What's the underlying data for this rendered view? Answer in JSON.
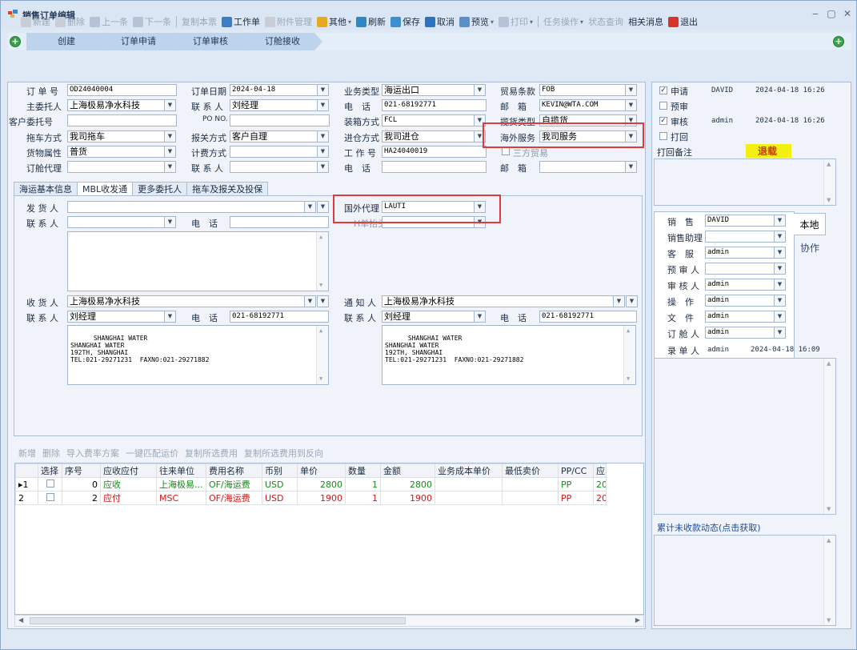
{
  "window": {
    "title": "销售订单编辑"
  },
  "toolbar": [
    {
      "label": "新建",
      "icon": "new-icon",
      "disabled": true
    },
    {
      "label": "删除",
      "icon": "delete-icon",
      "disabled": true
    },
    {
      "label": "上一条",
      "icon": "prev-icon",
      "disabled": true
    },
    {
      "label": "下一条",
      "icon": "next-icon",
      "disabled": true
    },
    {
      "label": "复制本票",
      "icon": "",
      "disabled": true
    },
    {
      "label": "工作单",
      "icon": "workorder-icon",
      "disabled": false
    },
    {
      "label": "附件管理",
      "icon": "attachment-icon",
      "disabled": true
    },
    {
      "label": "其他",
      "icon": "other-icon",
      "disabled": false,
      "dropdown": true
    },
    {
      "label": "刷新",
      "icon": "refresh-icon",
      "disabled": false
    },
    {
      "label": "保存",
      "icon": "save-icon",
      "disabled": false
    },
    {
      "label": "取消",
      "icon": "cancel-icon",
      "disabled": false
    },
    {
      "label": "预览",
      "icon": "preview-icon",
      "disabled": false,
      "dropdown": true
    },
    {
      "label": "打印",
      "icon": "print-icon",
      "disabled": true,
      "dropdown": true
    },
    {
      "label": "任务操作",
      "icon": "",
      "disabled": true,
      "dropdown": true
    },
    {
      "label": "状态查询",
      "icon": "",
      "disabled": true
    },
    {
      "label": "相关消息",
      "icon": "",
      "disabled": false
    },
    {
      "label": "退出",
      "icon": "exit-icon",
      "disabled": false
    }
  ],
  "flow": [
    "创建",
    "订单申请",
    "订单审核",
    "订舱接收"
  ],
  "form": {
    "order_no_label": "订 单 号",
    "order_no": "OD24040004",
    "order_date_label": "订单日期",
    "order_date": "2024-04-18",
    "biz_type_label": "业务类型",
    "biz_type": "海运出口",
    "trade_term_label": "贸易条款",
    "trade_term": "FOB",
    "principal_label": "主委托人",
    "principal": "上海极易净水科技",
    "contact_label": "联 系 人",
    "contact": "刘经理",
    "phone_label": "电　话",
    "phone": "021-68192771",
    "email_label": "邮　箱",
    "email": "KEVIN@WTA.COM",
    "customer_no_label": "客户委托号",
    "customer_no": "",
    "po_label": "PO NO.",
    "po": "",
    "loading_label": "装箱方式",
    "loading": "FCL",
    "pickup_type_label": "揽货类型",
    "pickup_type": "自揽货",
    "truck_label": "拖车方式",
    "truck": "我司拖车",
    "customs_label": "报关方式",
    "customs": "客户自理",
    "warehouse_label": "进仓方式",
    "warehouse": "我司进仓",
    "overseas_label": "海外服务",
    "overseas": "我司服务",
    "cargo_label": "货物属性",
    "cargo": "普货",
    "billing_label": "计费方式",
    "billing": "",
    "workno_label": "工 作 号",
    "workno": "HA24040019",
    "third_trade_label": "三方贸易",
    "booking_agent_label": "订舱代理",
    "booking_agent": "",
    "contact2_label": "联 系 人",
    "contact2": "",
    "phone2_label": "电　话",
    "phone2": "",
    "email2_label": "邮　箱",
    "email2": ""
  },
  "tabs": [
    "海运基本信息",
    "MBL收发通",
    "更多委托人",
    "拖车及报关及投保"
  ],
  "mbl": {
    "shipper_label": "发 货 人",
    "shipper": "",
    "contact_label": "联 系 人",
    "contact": "",
    "phone_label": "电　话",
    "phone": "",
    "overseas_agent_label": "国外代理",
    "overseas_agent": "LAUTI",
    "hbl_head_label": "H单抬头",
    "hbl_head": "",
    "consignee_label": "收 货 人",
    "consignee": "上海极易净水科技",
    "c_contact_label": "联 系 人",
    "c_contact": "刘经理",
    "c_phone_label": "电　话",
    "c_phone": "021-68192771",
    "c_address": "SHANGHAI WATER\nSHANGHAI WATER\n192TH, SHANGHAI\nTEL:021-29271231  FAXNO:021-29271882",
    "notify_label": "通 知 人",
    "notify": "上海极易净水科技",
    "n_contact_label": "联 系 人",
    "n_contact": "刘经理",
    "n_phone_label": "电　话",
    "n_phone": "021-68192771",
    "n_address": "SHANGHAI WATER\nSHANGHAI WATER\n192TH, SHANGHAI\nTEL:021-29271231  FAXNO:021-29271882"
  },
  "grid_toolbar": [
    "新增",
    "删除",
    "导入费率方案",
    "一键匹配运价",
    "复制所选费用",
    "复制所选费用到反向"
  ],
  "grid": {
    "columns": [
      "",
      "选择",
      "序号",
      "应收应付",
      "往来单位",
      "费用名称",
      "币别",
      "单价",
      "数量",
      "金额",
      "业务成本单价",
      "最低卖价",
      "PP/CC",
      "应"
    ],
    "rows": [
      {
        "idx": "▸1",
        "seq": "0",
        "type": "应收",
        "party": "上海极易...",
        "fee": "OF/海运费",
        "cur": "USD",
        "price": "2800",
        "qty": "1",
        "amount": "2800",
        "cost": "",
        "min": "",
        "ppcc": "PP",
        "extra": "20",
        "color": "#1a8a1a"
      },
      {
        "idx": "2",
        "seq": "2",
        "type": "应付",
        "party": "MSC",
        "fee": "OF/海运费",
        "cur": "USD",
        "price": "1900",
        "qty": "1",
        "amount": "1900",
        "cost": "",
        "min": "",
        "ppcc": "PP",
        "extra": "20",
        "color": "#d01818"
      }
    ]
  },
  "approval": {
    "items": [
      {
        "label": "申请",
        "checked": true,
        "user": "DAVID",
        "time": "2024-04-18 16:26"
      },
      {
        "label": "预审",
        "checked": false,
        "user": "",
        "time": ""
      },
      {
        "label": "审核",
        "checked": true,
        "user": "admin",
        "time": "2024-04-18 16:26"
      },
      {
        "label": "打回",
        "checked": false,
        "user": "",
        "time": ""
      }
    ],
    "remark_label": "打回备注",
    "retreat_label": "退载"
  },
  "staff": {
    "rows": [
      {
        "label": "销　售",
        "value": "DAVID"
      },
      {
        "label": "销售助理",
        "value": ""
      },
      {
        "label": "客　服",
        "value": "admin"
      },
      {
        "label": "预 审 人",
        "value": ""
      },
      {
        "label": "审 核 人",
        "value": "admin"
      },
      {
        "label": "操　作",
        "value": "admin"
      },
      {
        "label": "文　件",
        "value": "admin"
      },
      {
        "label": "订 舱 人",
        "value": "admin"
      }
    ],
    "tab_local": "本地",
    "tab_coop": "协作",
    "recorder_label": "录 单 人",
    "recorder": "admin",
    "recorder_time": "2024-04-18 16:09"
  },
  "receivable_label": "累计未收款动态(点击获取)"
}
